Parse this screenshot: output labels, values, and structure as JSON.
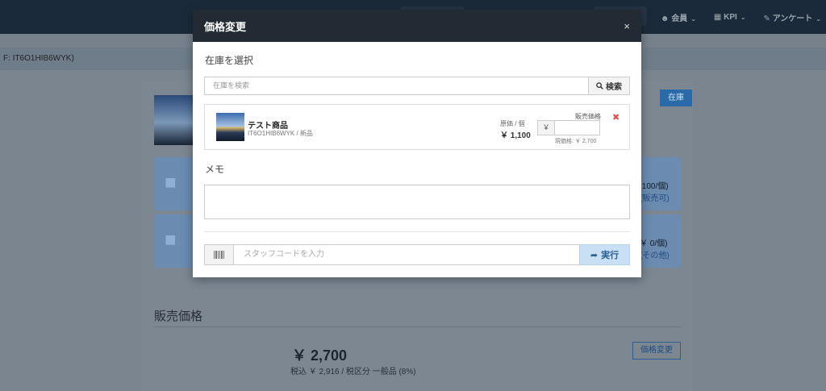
{
  "nav": {
    "menu": [
      {
        "icon": "user-icon",
        "label": "会員"
      },
      {
        "icon": "bar-chart-icon",
        "label": "KPI"
      },
      {
        "icon": "edit-icon",
        "label": "アンケート"
      }
    ]
  },
  "breadcrumb": {
    "text": "F: IT6O1HIB6WYK)"
  },
  "background": {
    "tag": "在庫",
    "stat1_text": ",100/個)",
    "stat1_link": "(販売可)",
    "stat2_text": "￥ 0/個)",
    "stat2_link": "(その他)",
    "price_heading": "販売価格",
    "price_main": "￥ 2,700",
    "price_sub": "税込 ￥ 2,916 / 税区分 一般品 (8%)",
    "price_change_button": "価格変更"
  },
  "modal": {
    "title": "価格変更",
    "close": "×",
    "stock_section_label": "在庫を選択",
    "search_placeholder": "在庫を検索",
    "search_button": "検索",
    "item": {
      "name": "テスト商品",
      "code": "IT6O1HIB6WYK / 新品",
      "cost_label": "原価 / 個",
      "cost_value": "￥ 1,100",
      "sale_price_label": "販売価格",
      "currency": "￥",
      "current_price": "現価格: ￥ 2,700",
      "remove": "✖"
    },
    "memo_label": "メモ",
    "staff_placeholder": "スタッフコードを入力",
    "exec_button": "実行"
  }
}
